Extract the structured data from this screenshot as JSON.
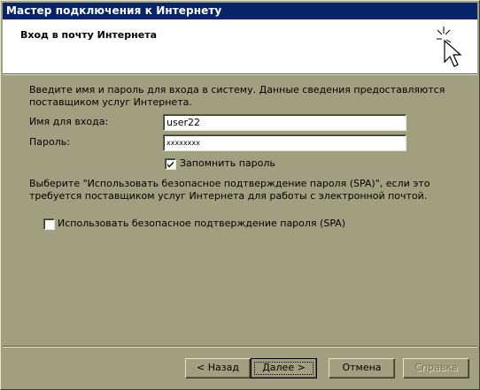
{
  "window": {
    "title": "Мастер подключения к Интернету"
  },
  "banner": {
    "title": "Вход в почту Интернета",
    "icon": "wizard-cursor-icon"
  },
  "intro": {
    "line1": "Введите имя и пароль для входа в систему. Данные сведения предоставляются",
    "line2": "поставщиком услуг Интернета."
  },
  "form": {
    "login_label": "Имя для входа:",
    "login_value": "user22",
    "password_label": "Пароль:",
    "password_value": "xxxxxxxx",
    "remember_label": "Запомнить пароль",
    "remember_checked": true
  },
  "spa": {
    "line1": "Выберите \"Использовать безопасное подтверждение пароля (SPA)\", если это",
    "line2": "требуется поставщиком услуг Интернета для работы с электронной почтой.",
    "checkbox_label": "Использовать безопасное подтверждение пароля (SPA)",
    "checked": false
  },
  "buttons": {
    "back": "< Назад",
    "next": "Далее >",
    "cancel": "Отмена",
    "help": "Справка"
  },
  "colors": {
    "titlebar": "#0a246a",
    "face": "#a09f7f",
    "window_bg": "#ffffff"
  }
}
